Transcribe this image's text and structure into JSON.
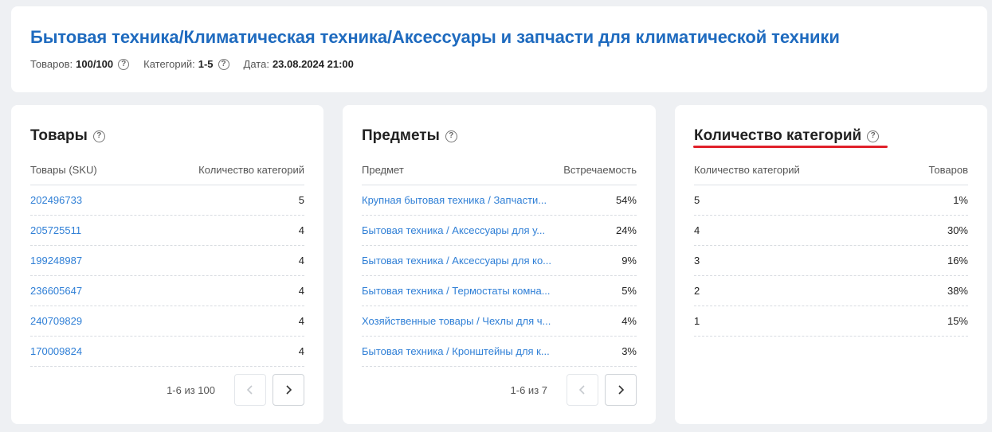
{
  "header": {
    "title": "Бытовая техника/Климатическая техника/Аксессуары и запчасти для климатической техники",
    "goods_label": "Товаров:",
    "goods_value": "100/100",
    "categories_label": "Категорий:",
    "categories_value": "1-5",
    "date_label": "Дата:",
    "date_value": "23.08.2024 21:00"
  },
  "products": {
    "title": "Товары",
    "col_left": "Товары (SKU)",
    "col_right": "Количество категорий",
    "rows": [
      {
        "sku": "202496733",
        "count": "5"
      },
      {
        "sku": "205725511",
        "count": "4"
      },
      {
        "sku": "199248987",
        "count": "4"
      },
      {
        "sku": "236605647",
        "count": "4"
      },
      {
        "sku": "240709829",
        "count": "4"
      },
      {
        "sku": "170009824",
        "count": "4"
      }
    ],
    "pager_info": "1-6 из 100"
  },
  "subjects": {
    "title": "Предметы",
    "col_left": "Предмет",
    "col_right": "Встречаемость",
    "rows": [
      {
        "name": "Крупная бытовая техника / Запчасти...",
        "pct": "54%"
      },
      {
        "name": "Бытовая техника / Аксессуары для у...",
        "pct": "24%"
      },
      {
        "name": "Бытовая техника / Аксессуары для ко...",
        "pct": "9%"
      },
      {
        "name": "Бытовая техника / Термостаты комна...",
        "pct": "5%"
      },
      {
        "name": "Хозяйственные товары / Чехлы для ч...",
        "pct": "4%"
      },
      {
        "name": "Бытовая техника / Кронштейны для к...",
        "pct": "3%"
      }
    ],
    "pager_info": "1-6 из 7"
  },
  "category_counts": {
    "title": "Количество категорий",
    "col_left": "Количество категорий",
    "col_right": "Товаров",
    "rows": [
      {
        "n": "5",
        "pct": "1%"
      },
      {
        "n": "4",
        "pct": "30%"
      },
      {
        "n": "3",
        "pct": "16%"
      },
      {
        "n": "2",
        "pct": "38%"
      },
      {
        "n": "1",
        "pct": "15%"
      }
    ]
  },
  "icons": {
    "help": "question-circle-icon",
    "prev": "chevron-left-icon",
    "next": "chevron-right-icon"
  },
  "colors": {
    "accent": "#1f6bbf",
    "link": "#2f7fd6",
    "highlight": "#e0202a"
  }
}
